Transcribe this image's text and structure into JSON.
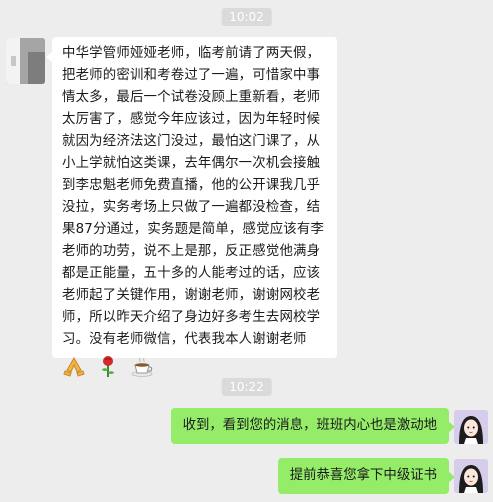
{
  "timestamps": [
    "10:02",
    "10:22"
  ],
  "incoming": {
    "text": "中华学管师娅娅老师，临考前请了两天假，把老师的密训和考卷过了一遍，可惜家中事情太多，最后一个试卷没顾上重新看，老师太厉害了，感觉今年应该过，因为年轻时候就因为经济法这门没过，最怕这门课了，从小上学就怕这类课，去年偶尔一次机会接触到李忠魁老师免费直播，他的公开课我几乎没拉，实务考场上只做了一遍都没检查，结果87分通过，实务题是简单，感觉应该有李老师的功劳，说不上是那，反正感觉他满身都是正能量，五十多的人能考过的话，应该老师起了关键作用，谢谢老师，谢谢网校老师，所以昨天介绍了身边好多考生去网校学习。没有老师微信，代表我本人谢谢老师",
    "emojis": [
      "salute-hands-icon",
      "rose-icon",
      "coffee-icon"
    ]
  },
  "outgoing": [
    {
      "text": "收到，看到您的消息，班班内心也是激动地"
    },
    {
      "text": "提前恭喜您拿下中级证书"
    }
  ],
  "colors": {
    "background": "#ededed",
    "incoming_bubble": "#ffffff",
    "outgoing_bubble": "#95ec69",
    "timestamp_bg": "#dadada"
  }
}
